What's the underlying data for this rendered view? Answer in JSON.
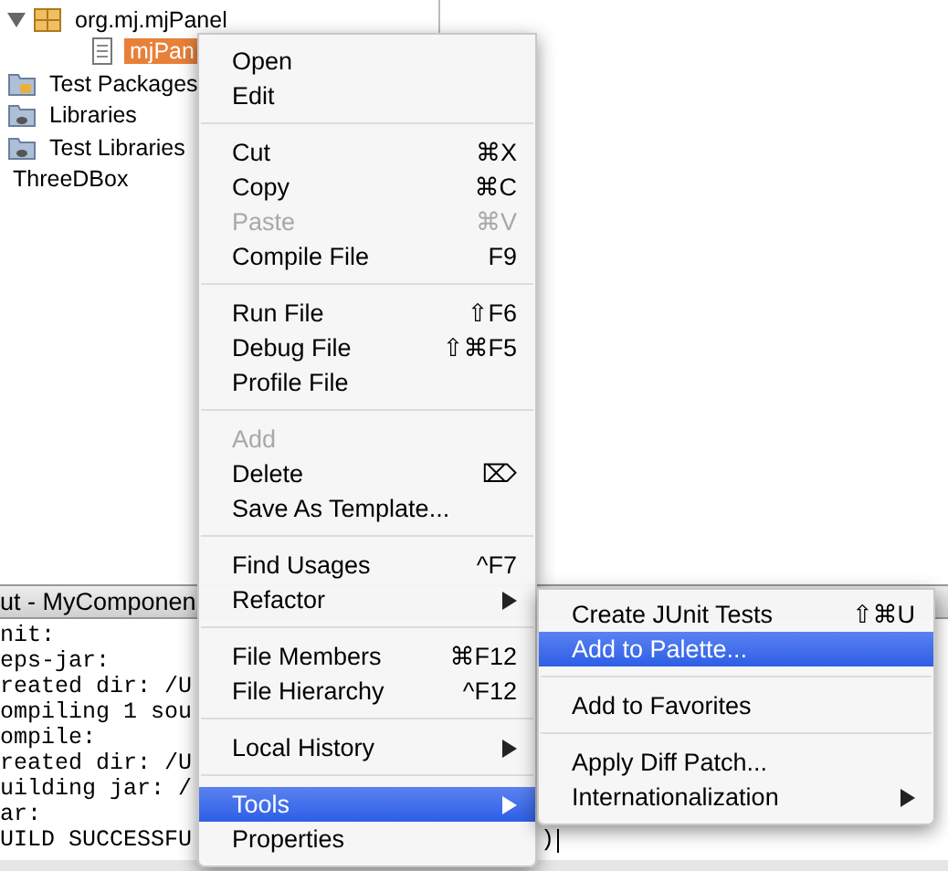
{
  "tree": [
    {
      "label": "org.mj.mjPanel",
      "kind": "package",
      "expanded": true,
      "selected": false,
      "children": [
        {
          "label": "mjPan",
          "kind": "file",
          "selected": true
        }
      ]
    },
    {
      "label": "Test Packages",
      "kind": "test-folder",
      "selected": false
    },
    {
      "label": "Libraries",
      "kind": "library",
      "selected": false
    },
    {
      "label": "Test Libraries",
      "kind": "library",
      "selected": false
    },
    {
      "label": "ThreeDBox",
      "kind": "plain",
      "selected": false
    }
  ],
  "output": {
    "title": "ut - MyComponen",
    "lines": [
      {
        "text": "nit:"
      },
      {
        "text": "eps-jar:"
      },
      {
        "text": "reated dir: /U"
      },
      {
        "text": "ompiling 1 sou"
      },
      {
        "text": "ompile:"
      },
      {
        "text": "reated dir: /U"
      },
      {
        "text": "uilding jar: /"
      },
      {
        "text": "ar:"
      },
      {
        "text": "UILD SUCCESSFU",
        "tail": ")"
      }
    ]
  },
  "context_menu": [
    {
      "kind": "item",
      "label": "Open",
      "disabled": false,
      "submenu": false,
      "selected": false
    },
    {
      "kind": "item",
      "label": "Edit",
      "disabled": false,
      "submenu": false,
      "selected": false
    },
    {
      "kind": "separator"
    },
    {
      "kind": "item",
      "label": "Cut",
      "shortcut": "⌘X",
      "disabled": false,
      "submenu": false,
      "selected": false
    },
    {
      "kind": "item",
      "label": "Copy",
      "shortcut": "⌘C",
      "disabled": false,
      "submenu": false,
      "selected": false
    },
    {
      "kind": "item",
      "label": "Paste",
      "shortcut": "⌘V",
      "disabled": true,
      "submenu": false,
      "selected": false
    },
    {
      "kind": "item",
      "label": "Compile File",
      "shortcut": "F9",
      "disabled": false,
      "submenu": false,
      "selected": false
    },
    {
      "kind": "separator"
    },
    {
      "kind": "item",
      "label": "Run File",
      "shortcut": "⇧F6",
      "disabled": false,
      "submenu": false,
      "selected": false
    },
    {
      "kind": "item",
      "label": "Debug File",
      "shortcut": "⇧⌘F5",
      "disabled": false,
      "submenu": false,
      "selected": false
    },
    {
      "kind": "item",
      "label": "Profile File",
      "disabled": false,
      "submenu": false,
      "selected": false
    },
    {
      "kind": "separator"
    },
    {
      "kind": "item",
      "label": "Add",
      "disabled": true,
      "submenu": false,
      "selected": false
    },
    {
      "kind": "item",
      "label": "Delete",
      "shortcut": "⌦",
      "disabled": false,
      "submenu": false,
      "selected": false
    },
    {
      "kind": "item",
      "label": "Save As Template...",
      "disabled": false,
      "submenu": false,
      "selected": false
    },
    {
      "kind": "separator"
    },
    {
      "kind": "item",
      "label": "Find Usages",
      "shortcut": "^F7",
      "disabled": false,
      "submenu": false,
      "selected": false
    },
    {
      "kind": "item",
      "label": "Refactor",
      "disabled": false,
      "submenu": true,
      "selected": false
    },
    {
      "kind": "separator"
    },
    {
      "kind": "item",
      "label": "File Members",
      "shortcut": "⌘F12",
      "disabled": false,
      "submenu": false,
      "selected": false
    },
    {
      "kind": "item",
      "label": "File Hierarchy",
      "shortcut": "^F12",
      "disabled": false,
      "submenu": false,
      "selected": false
    },
    {
      "kind": "separator"
    },
    {
      "kind": "item",
      "label": "Local History",
      "disabled": false,
      "submenu": true,
      "selected": false
    },
    {
      "kind": "separator"
    },
    {
      "kind": "item",
      "label": "Tools",
      "disabled": false,
      "submenu": true,
      "selected": true
    },
    {
      "kind": "item",
      "label": "Properties",
      "disabled": false,
      "submenu": false,
      "selected": false
    }
  ],
  "submenu": [
    {
      "kind": "item",
      "label": "Create JUnit Tests",
      "shortcut": "⇧⌘U",
      "disabled": false,
      "submenu": false,
      "selected": false
    },
    {
      "kind": "item",
      "label": "Add to Palette...",
      "disabled": false,
      "submenu": false,
      "selected": true
    },
    {
      "kind": "separator"
    },
    {
      "kind": "item",
      "label": "Add to Favorites",
      "disabled": false,
      "submenu": false,
      "selected": false
    },
    {
      "kind": "separator"
    },
    {
      "kind": "item",
      "label": "Apply Diff Patch...",
      "disabled": false,
      "submenu": false,
      "selected": false
    },
    {
      "kind": "item",
      "label": "Internationalization",
      "disabled": false,
      "submenu": true,
      "selected": false
    }
  ]
}
